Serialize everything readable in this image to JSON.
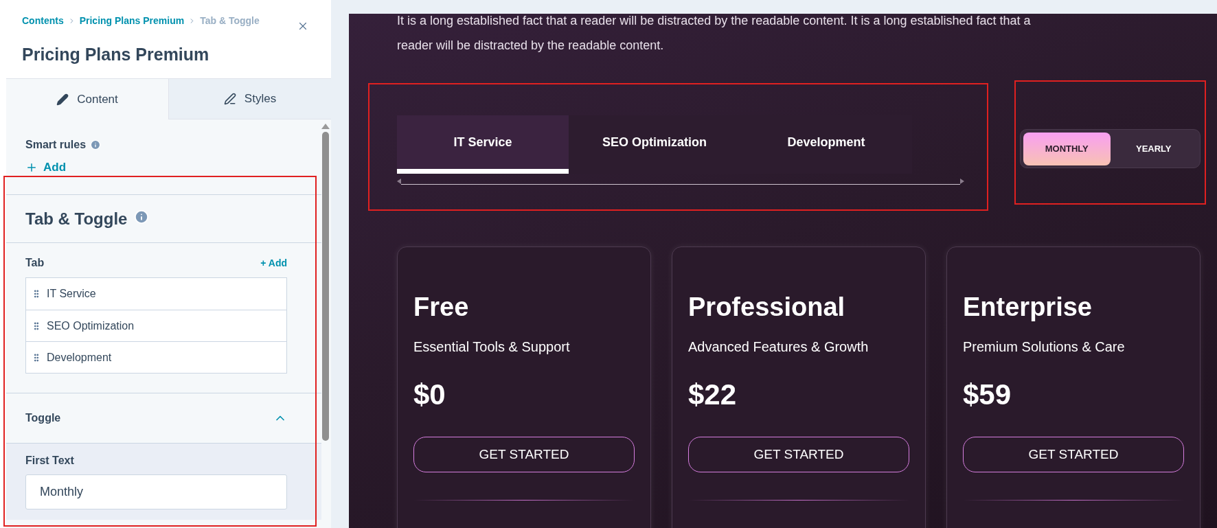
{
  "breadcrumb": [
    {
      "label": "Contents",
      "current": false
    },
    {
      "label": "Pricing Plans Premium",
      "current": false
    },
    {
      "label": "Tab & Toggle",
      "current": true
    }
  ],
  "panel": {
    "title": "Pricing Plans Premium",
    "tabs": [
      {
        "label": "Content",
        "selected": true
      },
      {
        "label": "Styles",
        "selected": false
      }
    ],
    "smart_rules": {
      "label": "Smart rules",
      "add": "Add"
    },
    "module_title": "Tab & Toggle",
    "tab_list": {
      "label": "Tab",
      "add": "+ Add",
      "items": [
        "IT Service",
        "SEO Optimization",
        "Development"
      ]
    },
    "toggle": {
      "label": "Toggle",
      "expanded": true,
      "first_text": {
        "label": "First Text",
        "value": "Monthly"
      }
    }
  },
  "preview": {
    "intro": "It is a long established fact that a reader will be distracted by the readable content. It is a long established fact that a reader will be distracted by the readable content.",
    "tabs": [
      {
        "label": "IT Service",
        "selected": true
      },
      {
        "label": "SEO Optimization",
        "selected": false
      },
      {
        "label": "Development",
        "selected": false
      }
    ],
    "toggle": [
      {
        "label": "MONTHLY",
        "selected": true
      },
      {
        "label": "YEARLY",
        "selected": false
      }
    ],
    "plans": [
      {
        "name": "Free",
        "subtitle": "Essential Tools & Support",
        "price": "$0",
        "button": "GET STARTED"
      },
      {
        "name": "Professional",
        "subtitle": "Advanced Features & Growth",
        "price": "$22",
        "button": "GET STARTED"
      },
      {
        "name": "Enterprise",
        "subtitle": "Premium Solutions & Care",
        "price": "$59",
        "button": "GET STARTED"
      }
    ]
  }
}
